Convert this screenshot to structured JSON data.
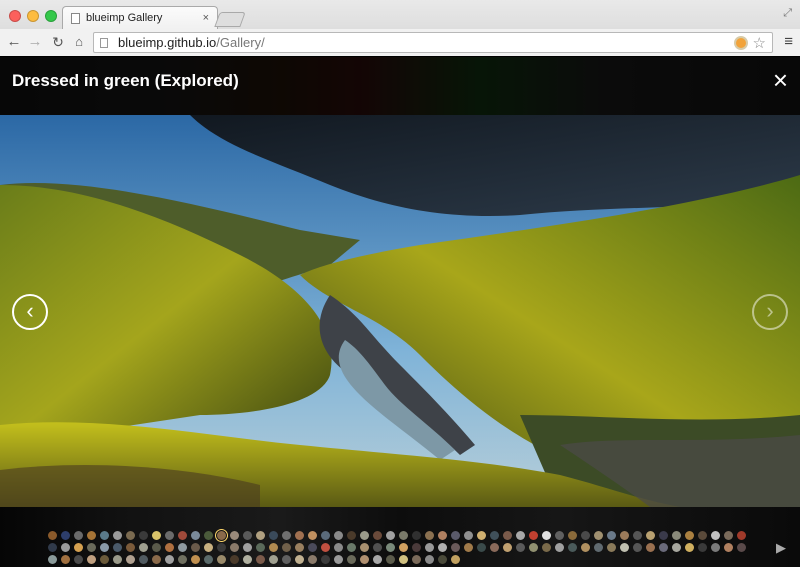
{
  "window": {
    "tab_title": "blueimp Gallery",
    "tab_close": "×"
  },
  "toolbar": {
    "back": "←",
    "forward": "→",
    "reload": "↻",
    "home": "⌂",
    "url_host": "blueimp.github.io",
    "url_path": "/Gallery/",
    "star": "☆",
    "menu": "≡"
  },
  "gallery": {
    "title": "Dressed in green (Explored)",
    "close": "×",
    "prev": "‹",
    "next": "›",
    "play": "▶",
    "thumb_colors": [
      "#8a5a2b",
      "#2d3e6b",
      "#6a6a6a",
      "#a67436",
      "#5a7a8a",
      "#9a9a9a",
      "#7a6a50",
      "#3a3a3a",
      "#d9c36a",
      "#6b6b6b",
      "#a04a3a",
      "#7a8a9a",
      "#4a5a3a",
      "#8a6a4a",
      "#9a8a7a",
      "#5a5a5a",
      "#b0a080",
      "#3a4a5a",
      "#707070",
      "#a07050",
      "#c09060",
      "#5a6a7a",
      "#8a8a8a",
      "#4a3a2a",
      "#9a9a8a",
      "#6a4a3a",
      "#a0a0a0",
      "#7a7a6a",
      "#303030",
      "#8a7050",
      "#b08060",
      "#5a5a6a",
      "#909090",
      "#d0b070",
      "#40505a",
      "#7a5a4a",
      "#a8a8a8",
      "#c04030",
      "#e0e0e0",
      "#606060",
      "#8a6a3a",
      "#4a4a4a",
      "#a09070",
      "#6a7a8a",
      "#9a7a5a",
      "#555555",
      "#b8a070",
      "#3a3a4a",
      "#8a8a7a",
      "#aa8040",
      "#5a4a3a",
      "#c0c0c0",
      "#7a6a5a",
      "#a03a2a",
      "#303a4a",
      "#9a9a9a",
      "#d4a050",
      "#6a6a5a",
      "#8a9aa8",
      "#4a5a6a",
      "#7a5a3a",
      "#a0a090",
      "#5a5a4a",
      "#b07040",
      "#909aa0",
      "#6a5a4a",
      "#c8b080",
      "#3a3a3a",
      "#8a7a6a",
      "#a0a0a0",
      "#5a6a5a",
      "#b08a50",
      "#70604a",
      "#9a8060",
      "#4a4a5a",
      "#c05040",
      "#8a8a8a",
      "#6a7a6a",
      "#a89070",
      "#505050",
      "#7a8a7a",
      "#d0a060",
      "#4a3a3a",
      "#9a9a9a",
      "#b0b0b0",
      "#6a5a5a",
      "#a07a4a",
      "#3a4a4a",
      "#8a6a5a",
      "#c0a070",
      "#5a5a5a",
      "#909070",
      "#7a6a4a",
      "#a0a0a0",
      "#4a5a5a",
      "#b09060",
      "#606a70",
      "#8a7a5a",
      "#c0c0b0",
      "#555555",
      "#9a7050",
      "#6a6a7a",
      "#a8a8a0",
      "#d0b060",
      "#3a3a3a",
      "#7a7a7a",
      "#b08060",
      "#5a4a4a",
      "#8a9a9a",
      "#a07040",
      "#4a4a4a",
      "#c0a080",
      "#6a5a3a",
      "#9a9a8a",
      "#b0a090",
      "#505a60",
      "#8a6a4a",
      "#a0a0a0",
      "#707060",
      "#c09050",
      "#5a6a6a",
      "#9a8a6a",
      "#4a3a2a",
      "#b0b0a0",
      "#7a5a4a",
      "#a0a090",
      "#606060",
      "#c0b090",
      "#8a7a6a",
      "#3a3a3a",
      "#9a9a9a",
      "#6a6a5a",
      "#b09070",
      "#a8a8a8",
      "#5a5a4a",
      "#d0c080",
      "#7a6a5a",
      "#8a8a8a",
      "#4a4a3a",
      "#c0a060"
    ],
    "active_thumb_index": 13
  }
}
